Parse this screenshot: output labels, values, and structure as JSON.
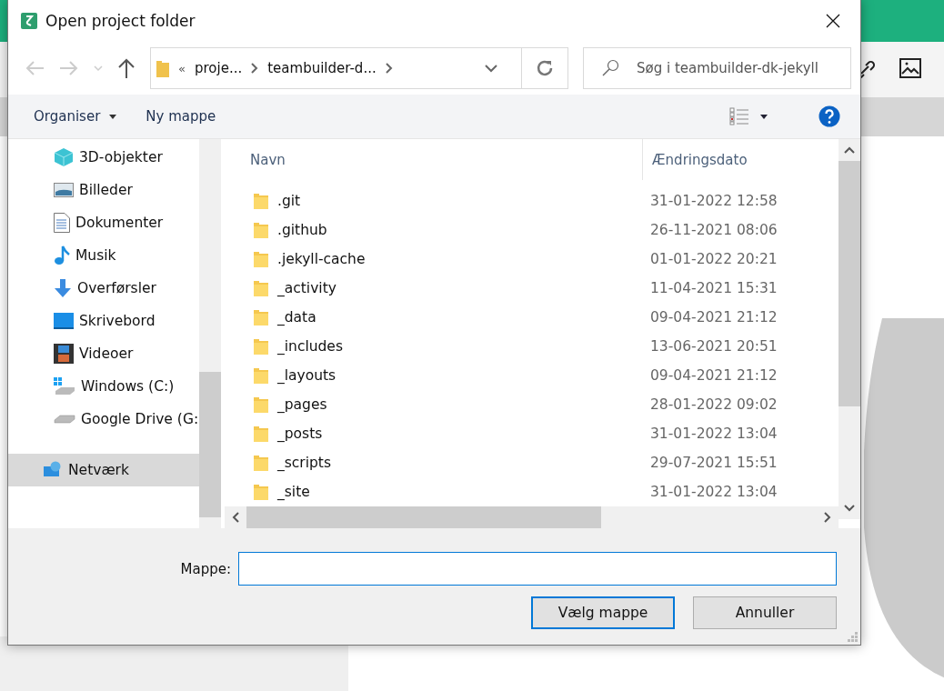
{
  "window": {
    "title": "Open project folder"
  },
  "address": {
    "overflow": "«",
    "crumbs": [
      "proje...",
      "teambuilder-d..."
    ]
  },
  "search": {
    "placeholder": "Søg i teambuilder-dk-jekyll"
  },
  "commands": {
    "organise": "Organiser",
    "new_folder": "Ny mappe"
  },
  "sidebar": {
    "items": [
      {
        "label": "3D-objekter",
        "kind": "cube",
        "selected": false
      },
      {
        "label": "Billeder",
        "kind": "pictures",
        "selected": false
      },
      {
        "label": "Dokumenter",
        "kind": "document",
        "selected": false
      },
      {
        "label": "Musik",
        "kind": "music",
        "selected": false
      },
      {
        "label": "Overførsler",
        "kind": "download",
        "selected": false
      },
      {
        "label": "Skrivebord",
        "kind": "desktop",
        "selected": false
      },
      {
        "label": "Videoer",
        "kind": "video",
        "selected": false
      },
      {
        "label": "Windows  (C:)",
        "kind": "windrive",
        "selected": false
      },
      {
        "label": "Google Drive (G:",
        "kind": "drive",
        "selected": false
      },
      {
        "label": "Netværk",
        "kind": "network",
        "selected": true
      }
    ]
  },
  "table": {
    "columns": [
      "Navn",
      "Ændringsdato"
    ],
    "rows": [
      {
        "name": ".git",
        "date": "31-01-2022 12:58"
      },
      {
        "name": ".github",
        "date": "26-11-2021 08:06"
      },
      {
        "name": ".jekyll-cache",
        "date": "01-01-2022 20:21"
      },
      {
        "name": "_activity",
        "date": "11-04-2021 15:31"
      },
      {
        "name": "_data",
        "date": "09-04-2021 21:12"
      },
      {
        "name": "_includes",
        "date": "13-06-2021 20:51"
      },
      {
        "name": "_layouts",
        "date": "09-04-2021 21:12"
      },
      {
        "name": "_pages",
        "date": "28-01-2022 09:02"
      },
      {
        "name": "_posts",
        "date": "31-01-2022 13:04"
      },
      {
        "name": "_scripts",
        "date": "29-07-2021 15:51"
      },
      {
        "name": "_site",
        "date": "31-01-2022 13:04"
      }
    ]
  },
  "folder_field": {
    "label": "Mappe:"
  },
  "buttons": [
    "Vælg mappe",
    "Annuller"
  ]
}
